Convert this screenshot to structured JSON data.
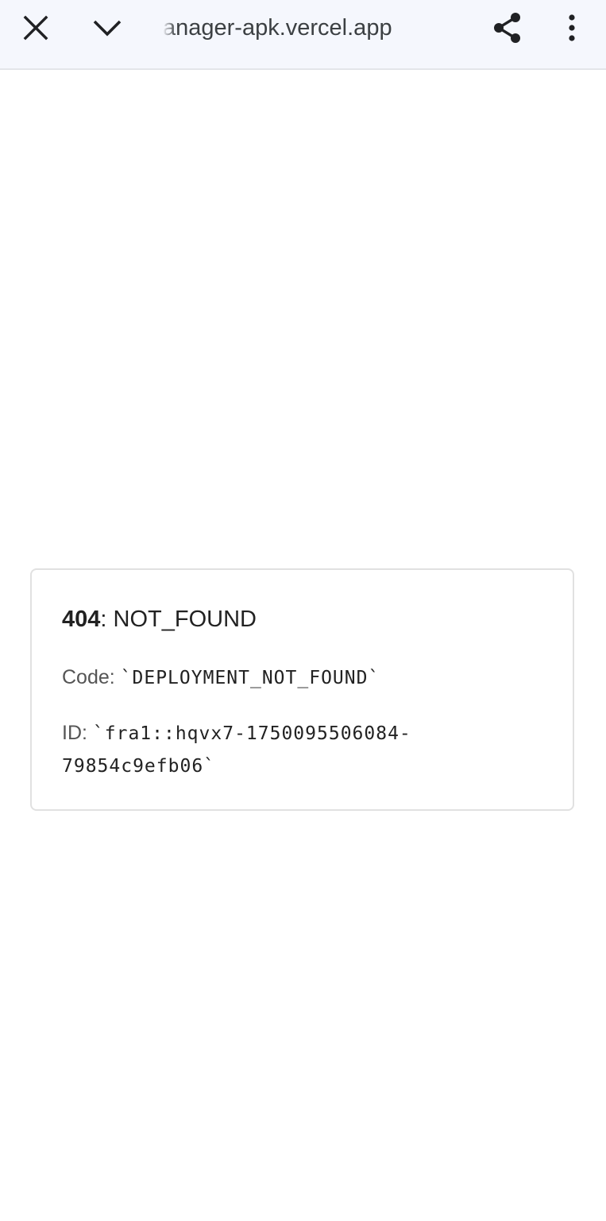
{
  "browser": {
    "url_text": "anager-apk.vercel.app",
    "icons": {
      "close": "close-icon",
      "collapse": "chevron-down-icon",
      "share": "share-icon",
      "menu": "more-vert-icon"
    },
    "toolbar_bg": "#f5f7fd"
  },
  "error": {
    "status_code": "404",
    "status_separator": ": ",
    "status_text": "NOT_FOUND",
    "code_label": "Code: ",
    "code_value": "`DEPLOYMENT_NOT_FOUND`",
    "id_label": "ID: ",
    "id_value_part1": "`fra1::hqvx7-1750095506084-",
    "id_value_part2": "79854c9efb06`"
  }
}
